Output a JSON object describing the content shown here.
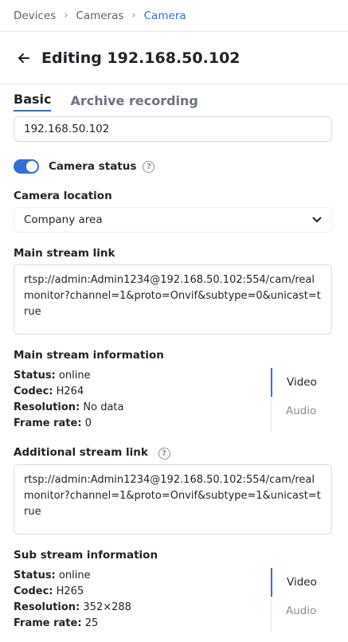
{
  "breadcrumb": {
    "items": [
      "Devices",
      "Cameras",
      "Camera"
    ]
  },
  "header": {
    "title": "Editing 192.168.50.102"
  },
  "tabs": [
    {
      "label": "Basic"
    },
    {
      "label": "Archive recording"
    }
  ],
  "name_field": {
    "value": "192.168.50.102"
  },
  "camera_status": {
    "label": "Camera status",
    "enabled": true
  },
  "location": {
    "label": "Camera location",
    "value": "Company area"
  },
  "main_stream": {
    "link_label": "Main stream link",
    "link": "rtsp://admin:Admin1234@192.168.50.102:554/cam/realmonitor?channel=1&proto=Onvif&subtype=0&unicast=true",
    "info_label": "Main stream information",
    "status_key": "Status:",
    "status": "online",
    "codec_key": "Codec:",
    "codec": "H264",
    "resolution_key": "Resolution:",
    "resolution": "No data",
    "framerate_key": "Frame rate:",
    "framerate": "0",
    "video_label": "Video",
    "audio_label": "Audio"
  },
  "sub_stream": {
    "link_label": "Additional stream link",
    "link": "rtsp://admin:Admin1234@192.168.50.102:554/cam/realmonitor?channel=1&proto=Onvif&subtype=1&unicast=true",
    "info_label": "Sub stream information",
    "status_key": "Status:",
    "status": "online",
    "codec_key": "Codec:",
    "codec": "H265",
    "resolution_key": "Resolution:",
    "resolution": "352×288",
    "framerate_key": "Frame rate:",
    "framerate": "25",
    "video_label": "Video",
    "audio_label": "Audio"
  },
  "icons": {
    "back": "arrow-left-icon",
    "help": "question-circle-icon",
    "dropdown": "chevron-down-icon",
    "separator": "chevron-right-icon"
  },
  "colors": {
    "accent": "#2f6fd6"
  }
}
